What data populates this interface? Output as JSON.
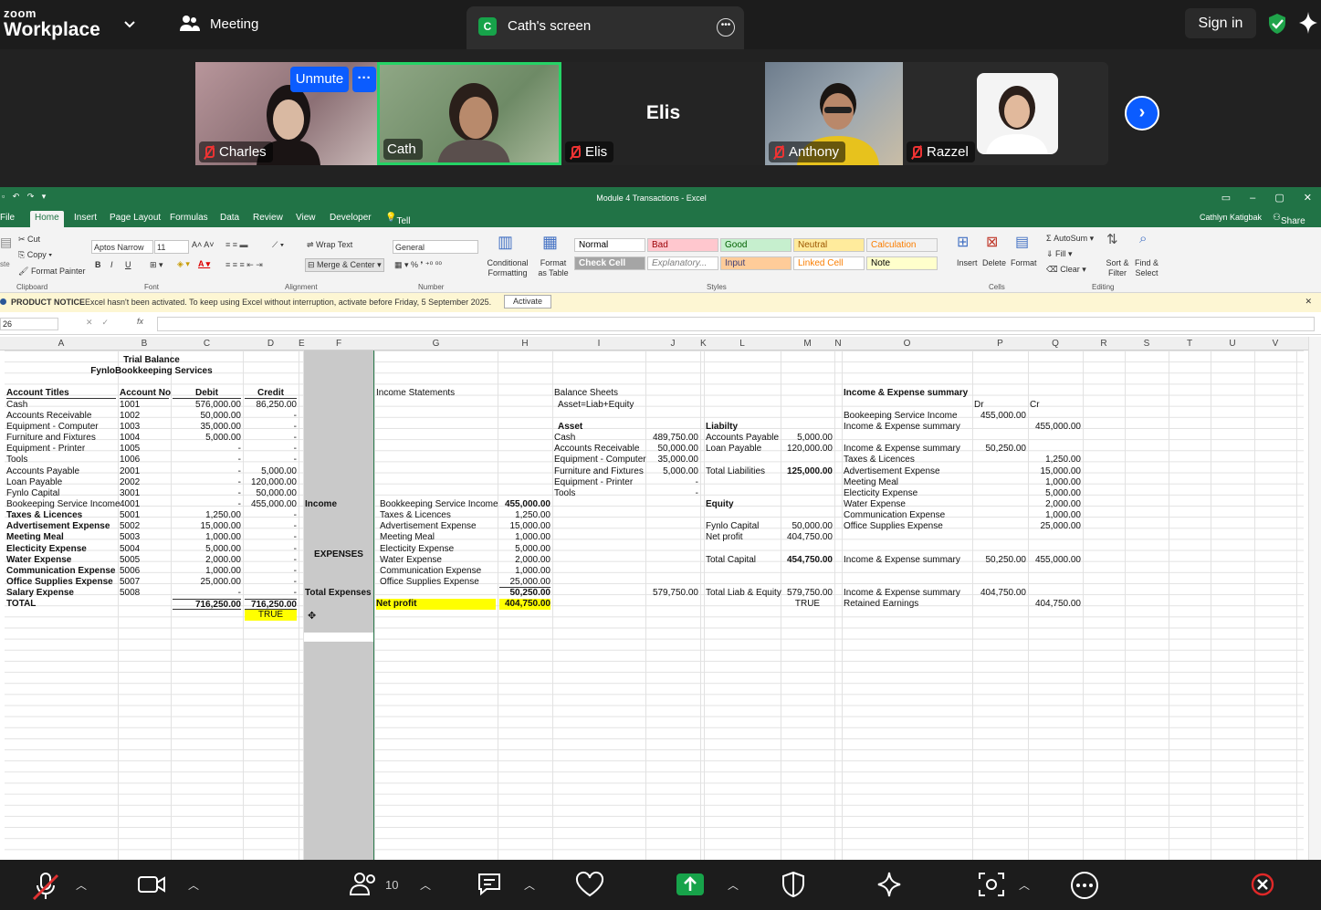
{
  "topbar": {
    "logo_line1": "zoom",
    "logo_line2": "Workplace",
    "meeting_label": "Meeting",
    "share_tab_initial": "C",
    "share_tab_label": "Cath's screen",
    "signin_label": "Sign in"
  },
  "participants": [
    {
      "name": "Charles",
      "muted": true,
      "unmute_label": "Unmute",
      "more": "···"
    },
    {
      "name": "Cath",
      "muted": false,
      "active": true
    },
    {
      "name": "Elis",
      "muted": true,
      "center_label": "Elis"
    },
    {
      "name": "Anthony",
      "muted": true
    },
    {
      "name": "Razzel",
      "muted": true
    }
  ],
  "excel": {
    "title": "Module 4 Transactions - Excel",
    "tabs": [
      "File",
      "Home",
      "Insert",
      "Page Layout",
      "Formulas",
      "Data",
      "Review",
      "View",
      "Developer"
    ],
    "tell_me": "Tell me what you want to do...",
    "user": "Cathlyn Katigbak",
    "share": "Share",
    "ribbon": {
      "clipboard": {
        "cut": "Cut",
        "copy": "Copy",
        "format_painter": "Format Painter",
        "label": "Clipboard",
        "paste": "ste"
      },
      "font": {
        "name": "Aptos Narrow",
        "size": "11",
        "label": "Font"
      },
      "alignment": {
        "wrap": "Wrap Text",
        "merge": "Merge & Center",
        "label": "Alignment"
      },
      "number": {
        "format": "General",
        "label": "Number"
      },
      "styles": {
        "cond": "Conditional Formatting",
        "fmt_table": "Format as Table",
        "label": "Styles",
        "boxes": [
          {
            "t": "Normal",
            "bg": "#ffffff",
            "fg": "#000"
          },
          {
            "t": "Bad",
            "bg": "#ffc7ce",
            "fg": "#9c0006"
          },
          {
            "t": "Good",
            "bg": "#c6efce",
            "fg": "#006100"
          },
          {
            "t": "Neutral",
            "bg": "#ffeb9c",
            "fg": "#9c5700"
          },
          {
            "t": "Calculation",
            "bg": "#f2f2f2",
            "fg": "#fa7d00"
          },
          {
            "t": "Check Cell",
            "bg": "#a5a5a5",
            "fg": "#ffffff"
          },
          {
            "t": "Explanatory...",
            "bg": "#ffffff",
            "fg": "#7f7f7f"
          },
          {
            "t": "Input",
            "bg": "#ffcc99",
            "fg": "#3f3f76"
          },
          {
            "t": "Linked Cell",
            "bg": "#ffffff",
            "fg": "#fa7d00"
          },
          {
            "t": "Note",
            "bg": "#ffffcc",
            "fg": "#000"
          }
        ]
      },
      "cells": {
        "insert": "Insert",
        "delete": "Delete",
        "format": "Format",
        "label": "Cells"
      },
      "editing": {
        "autosum": "AutoSum",
        "fill": "Fill",
        "clear": "Clear",
        "sort": "Sort & Filter",
        "find": "Find & Select",
        "label": "Editing"
      }
    },
    "notice": {
      "tag": "PRODUCT NOTICE",
      "text": "Excel hasn't been activated. To keep using Excel without interruption, activate before Friday, 5 September 2025.",
      "button": "Activate"
    },
    "name_box": "26",
    "columns": [
      "A",
      "B",
      "C",
      "D",
      "E",
      "F",
      "G",
      "H",
      "I",
      "J",
      "K",
      "L",
      "M",
      "N",
      "O",
      "P",
      "Q",
      "R",
      "S",
      "T",
      "U",
      "V"
    ],
    "trial_balance": {
      "title": "Trial Balance",
      "company": "FynloBookkeeping Services",
      "headers": [
        "Account Titles",
        "Account No",
        "Debit",
        "Credit"
      ],
      "rows": [
        [
          "Cash",
          "1001",
          "576,000.00",
          "86,250.00"
        ],
        [
          "Accounts Receivable",
          "1002",
          "50,000.00",
          "-"
        ],
        [
          "Equipment - Computer",
          "1003",
          "35,000.00",
          "-"
        ],
        [
          "Furniture and Fixtures",
          "1004",
          "5,000.00",
          "-"
        ],
        [
          "Equipment - Printer",
          "1005",
          "-",
          "-"
        ],
        [
          "Tools",
          "1006",
          "-",
          "-"
        ],
        [
          "Accounts Payable",
          "2001",
          "-",
          "5,000.00"
        ],
        [
          "Loan Payable",
          "2002",
          "-",
          "120,000.00"
        ],
        [
          "Fynlo Capital",
          "3001",
          "-",
          "50,000.00"
        ],
        [
          "Bookeeping Service Income",
          "4001",
          "-",
          "455,000.00"
        ],
        [
          "Taxes & Licences",
          "5001",
          "1,250.00",
          "-"
        ],
        [
          "Advertisement Expense",
          "5002",
          "15,000.00",
          "-"
        ],
        [
          "Meeting Meal",
          "5003",
          "1,000.00",
          "-"
        ],
        [
          "Electicity Expense",
          "5004",
          "5,000.00",
          "-"
        ],
        [
          "Water Expense",
          "5005",
          "2,000.00",
          "-"
        ],
        [
          "Communication Expense",
          "5006",
          "1,000.00",
          "-"
        ],
        [
          "Office Supplies Expense",
          "5007",
          "25,000.00",
          "-"
        ],
        [
          "Salary Expense",
          "5008",
          "-",
          "-"
        ]
      ],
      "total": [
        "TOTAL",
        "",
        "716,250.00",
        "716,250.00"
      ],
      "check": "TRUE"
    },
    "f_col": {
      "income": "Income",
      "expenses": "EXPENSES",
      "total_expenses": "Total Expenses"
    },
    "income_statement": {
      "title": "Income Statements",
      "income": [
        "Bookkeeping Service Income",
        "455,000.00"
      ],
      "expenses": [
        [
          "Taxes & Licences",
          "1,250.00"
        ],
        [
          "Advertisement Expense",
          "15,000.00"
        ],
        [
          "Meeting Meal",
          "1,000.00"
        ],
        [
          "Electicity Expense",
          "5,000.00"
        ],
        [
          "Water Expense",
          "2,000.00"
        ],
        [
          "Communication Expense",
          "1,000.00"
        ],
        [
          "Office Supplies Expense",
          "25,000.00"
        ]
      ],
      "total_expenses": "50,250.00",
      "net_profit_label": "Net profit",
      "net_profit": "404,750.00"
    },
    "balance_sheet": {
      "title": "Balance Sheets",
      "equation": "Asset=Liab+Equity",
      "asset_label": "Asset",
      "assets": [
        [
          "Cash",
          "489,750.00"
        ],
        [
          "Accounts Receivable",
          "50,000.00"
        ],
        [
          "Equipment - Computer",
          "35,000.00"
        ],
        [
          "Furniture and Fixtures",
          "5,000.00"
        ],
        [
          "Equipment - Printer",
          "-"
        ],
        [
          "Tools",
          "-"
        ]
      ],
      "total_assets": "579,750.00",
      "liab_label": "Liabilty",
      "liabilities": [
        [
          "Accounts Payable",
          "5,000.00"
        ],
        [
          "Loan Payable",
          "120,000.00"
        ]
      ],
      "total_liab": [
        "Total Liabilities",
        "125,000.00"
      ],
      "equity_label": "Equity",
      "equity": [
        [
          "Fynlo Capital",
          "50,000.00"
        ],
        [
          "Net profit",
          "404,750.00"
        ]
      ],
      "total_capital": [
        "Total Capital",
        "454,750.00"
      ],
      "total_liab_eq": [
        "Total Liab & Equity",
        "579,750.00"
      ],
      "check": "TRUE"
    },
    "ie_summary": {
      "title": "Income & Expense summary",
      "dr": "Dr",
      "cr": "Cr",
      "rows": [
        [
          "Bookeeping Service Income",
          "455,000.00",
          ""
        ],
        [
          "Income & Expense summary",
          "",
          "455,000.00"
        ],
        [
          "",
          "",
          ""
        ],
        [
          "Income & Expense summary",
          "50,250.00",
          ""
        ],
        [
          "Taxes & Licences",
          "",
          "1,250.00"
        ],
        [
          "Advertisement Expense",
          "",
          "15,000.00"
        ],
        [
          "Meeting Meal",
          "",
          "1,000.00"
        ],
        [
          "Electicity Expense",
          "",
          "5,000.00"
        ],
        [
          "Water Expense",
          "",
          "2,000.00"
        ],
        [
          "Communication Expense",
          "",
          "1,000.00"
        ],
        [
          "Office Supplies Expense",
          "",
          "25,000.00"
        ],
        [
          "",
          "",
          ""
        ],
        [
          "",
          "",
          ""
        ],
        [
          "Income & Expense summary",
          "50,250.00",
          "455,000.00"
        ],
        [
          "",
          "",
          ""
        ],
        [
          "",
          "",
          ""
        ],
        [
          "Income & Expense summary",
          "404,750.00",
          ""
        ],
        [
          "Retained Earnings",
          "",
          "404,750.00"
        ]
      ]
    }
  },
  "toolbar": {
    "participants_count": "10"
  },
  "colors": {
    "excel_green": "#217346",
    "zoom_blue": "#0b5cff",
    "share_green": "#17a34a",
    "highlight": "#ffff00",
    "end_red": "#e02828"
  }
}
